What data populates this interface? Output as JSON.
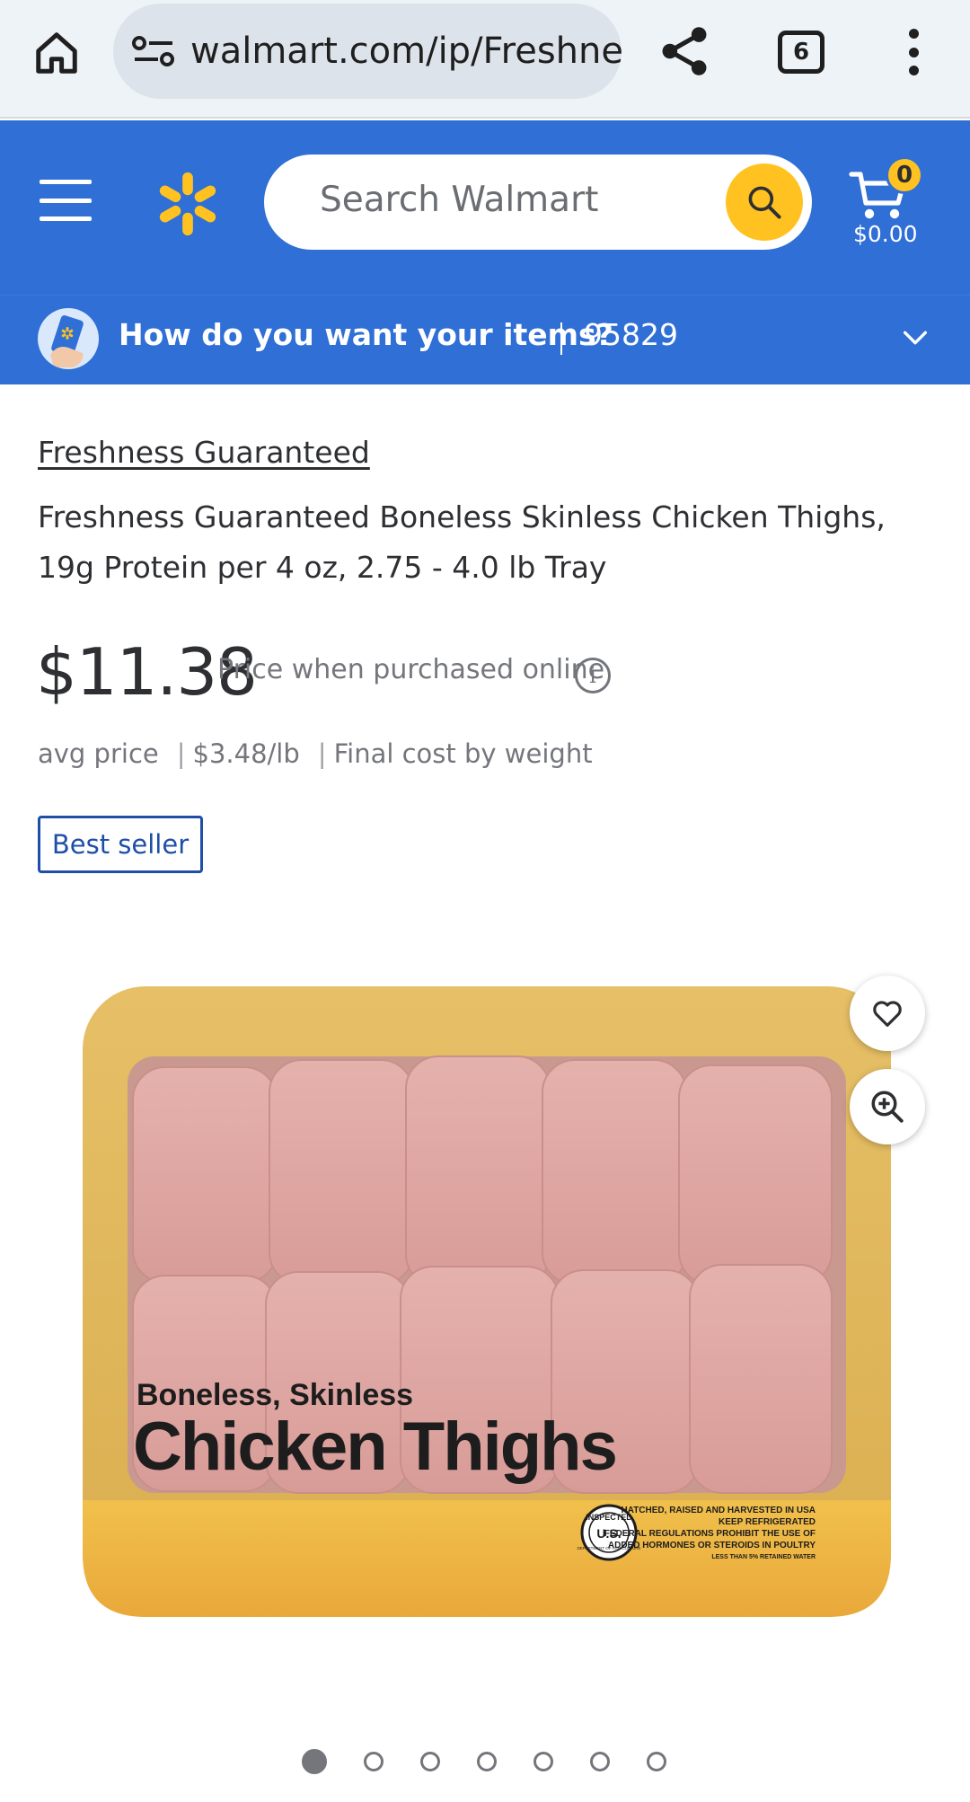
{
  "browser": {
    "url": "walmart.com/ip/Freshne",
    "tab_count": "6"
  },
  "header": {
    "search_placeholder": "Search Walmart",
    "cart_count": "0",
    "cart_total": "$0.00"
  },
  "delivery": {
    "question": "How do you want your items?",
    "zip": "95829"
  },
  "product": {
    "brand": "Freshness Guaranteed",
    "title": "Freshness Guaranteed Boneless Skinless Chicken Thighs, 19g Protein per 4 oz, 2.75 - 4.0 lb Tray",
    "price": "$11.38",
    "price_note": "Price when purchased online",
    "avg_label": "avg price",
    "unit_price": "$3.48/lb",
    "final_cost": "Final cost by weight",
    "badge": "Best seller"
  },
  "image": {
    "label_line1": "Boneless, Skinless",
    "label_line2": "Chicken Thighs",
    "seal_top": "INSPECTED",
    "seal_mid": "U.S.",
    "seal_bottom": "DEPARTMENT OF AGRICULTURE",
    "fine_print": [
      "HATCHED, RAISED AND HARVESTED IN USA",
      "KEEP REFRIGERATED",
      "FEDERAL REGULATIONS PROHIBIT THE USE OF",
      "ADDED HORMONES OR STEROIDS IN POULTRY",
      "LESS THAN 5% RETAINED WATER"
    ]
  },
  "carousel": {
    "total": 7,
    "active_index": 0
  },
  "colors": {
    "walmart_blue": "#2f6fd6",
    "spark_yellow": "#ffc220",
    "badge_blue": "#1e4fa8"
  }
}
